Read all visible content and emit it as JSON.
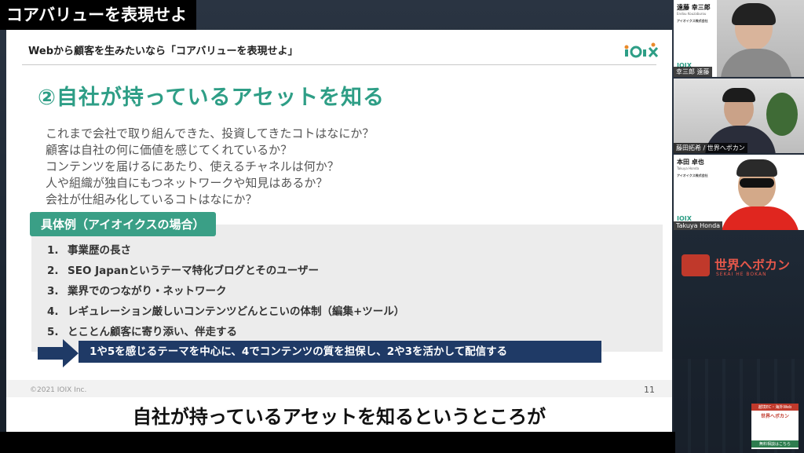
{
  "video_title_tag": "コアバリューを表現せよ",
  "slide": {
    "header": "Webから顧客を生みたいなら「コアバリューを表現せよ」",
    "logo_text": "IOIX",
    "title": "②自社が持っているアセットを知る",
    "questions": [
      "これまで会社で取り組んできた、投資してきたコトはなにか？",
      "顧客は自社の何に価値を感じてくれているか？",
      "コンテンツを届けるにあたり、使えるチャネルは何か？",
      "人や組織が独自にもつネットワークや知見はあるか？",
      "会社が仕組み化しているコトはなにか？"
    ],
    "example_label": "具体例（アイオイクスの場合）",
    "examples": [
      {
        "num": "1.",
        "text": "事業歴の長さ"
      },
      {
        "num": "2.",
        "text": "SEO Japanというテーマ特化ブログとそのユーザー"
      },
      {
        "num": "3.",
        "text": "業界でのつながり・ネットワーク"
      },
      {
        "num": "4.",
        "text": "レギュレーション厳しいコンテンツどんとこいの体制（編集+ツール）"
      },
      {
        "num": "5.",
        "text": "とことん顧客に寄り添い、伴走する"
      }
    ],
    "callout": "1や5を感じるテーマを中心に、4でコンテンツの質を担保し、2や3を活かして配信する",
    "copyright": "©2021 IOIX Inc.",
    "page_number": "11",
    "accent_color": "#2e9e86",
    "callout_color": "#1f3a66"
  },
  "participants": [
    {
      "card_name": "遠藤 幸三郎",
      "card_romaji": "Endou Kouzaburou",
      "card_company": "アイオイクス株式会社",
      "card_logo": "IOIX",
      "name_tag": "幸三郎 遠藤"
    },
    {
      "name_tag": "藤田拓希 / 世界へボカン"
    },
    {
      "card_name": "本田 卓也",
      "card_romaji": "Takuya Honda",
      "card_company": "アイオイクス株式会社",
      "card_logo": "IOIX",
      "name_tag": "Takuya Honda"
    }
  ],
  "channel": {
    "name": "世界へボカン",
    "subtitle": "SEKAI HE BOKAN"
  },
  "subtitle": "自社が持っているアセットを知るというところが",
  "ad": {
    "top": "越境EC・海外Web",
    "mid": "世界へボカン",
    "bottom": "無料相談はこちら"
  }
}
